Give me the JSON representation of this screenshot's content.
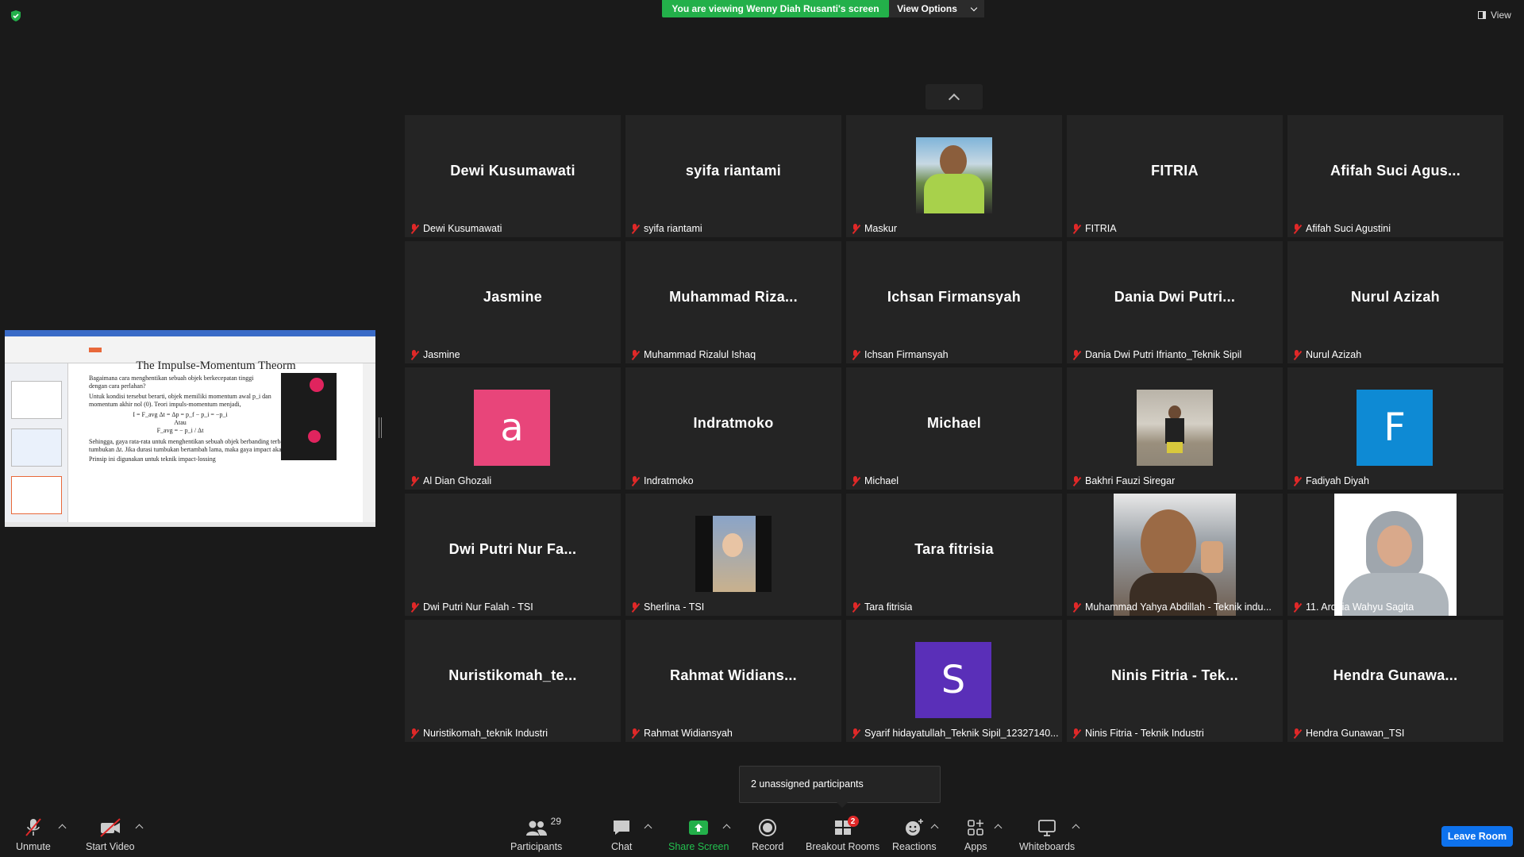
{
  "banner": {
    "viewing": "You are viewing Wenny Diah Rusanti's screen",
    "options": "View Options"
  },
  "view": {
    "label": "View"
  },
  "share_slide": {
    "title": "The Impulse-Momentum Theorm",
    "bullets": [
      "Bagaimana cara menghentikan sebuah objek berkecepatan tinggi dengan cara perlahan?",
      "Untuk kondisi tersebut berarti, objek memiliki momentum awal p_i dan momentum akhir nol (0). Teori impuls-momentum menjadi,",
      "Sehingga, gaya rata-rata untuk menghentikan sebuah objek berbanding terbalik dengan durasi tumbukan Δt. Jika durasi tumbukan bertambah lama, maka gaya impact akan berkurang.",
      "Prinsip ini digunakan untuk teknik impact-lossing"
    ],
    "eq1": "I = F_avg Δt = Δp = p_f − p_i = −p_i",
    "eq_or": "Atau",
    "eq2": "F_avg = − p_i / Δt"
  },
  "participants": [
    {
      "big": "Dewi Kusumawati",
      "label": "Dewi Kusumawati"
    },
    {
      "big": "syifa riantami",
      "label": "syifa riantami"
    },
    {
      "big": "",
      "label": "Maskur"
    },
    {
      "big": "FITRIA",
      "label": "FITRIA"
    },
    {
      "big": "Afifah  Suci  Agus...",
      "label": "Afifah Suci Agustini"
    },
    {
      "big": "Jasmine",
      "label": "Jasmine"
    },
    {
      "big": "Muhammad  Riza...",
      "label": "Muhammad Rizalul Ishaq"
    },
    {
      "big": "Ichsan Firmansyah",
      "label": "Ichsan Firmansyah"
    },
    {
      "big": "Dania  Dwi  Putri...",
      "label": "Dania Dwi Putri Ifrianto_Teknik Sipil"
    },
    {
      "big": "Nurul Azizah",
      "label": "Nurul Azizah"
    },
    {
      "big": "a",
      "label": "Al Dian Ghozali"
    },
    {
      "big": "Indratmoko",
      "label": "Indratmoko"
    },
    {
      "big": "Michael",
      "label": "Michael"
    },
    {
      "big": "",
      "label": "Bakhri Fauzi Siregar"
    },
    {
      "big": "F",
      "label": "Fadiyah Diyah"
    },
    {
      "big": "Dwi Putri Nur Fa...",
      "label": "Dwi Putri Nur Falah - TSI"
    },
    {
      "big": "",
      "label": "Sherlina - TSI"
    },
    {
      "big": "Tara fitrisia",
      "label": "Tara fitrisia"
    },
    {
      "big": "",
      "label": "Muhammad Yahya Abdillah - Teknik indu..."
    },
    {
      "big": "",
      "label": "11. Ardhia Wahyu Sagita"
    },
    {
      "big": "Nuristikomah_te...",
      "label": "Nuristikomah_teknik Industri"
    },
    {
      "big": "Rahmat  Widians...",
      "label": "Rahmat Widiansyah"
    },
    {
      "big": "S",
      "label": "Syarif hidayatullah_Teknik Sipil_12327140..."
    },
    {
      "big": "Ninis Fitria - Tek...",
      "label": "Ninis Fitria - Teknik Industri"
    },
    {
      "big": "Hendra  Gunawa...",
      "label": "Hendra Gunawan_TSI"
    }
  ],
  "avatar_colors": {
    "a": "#e8457a",
    "F": "#0e8ad4",
    "S": "#5a2fb8"
  },
  "tooltip": "2 unassigned participants",
  "toolbar": {
    "unmute": "Unmute",
    "start_video": "Start Video",
    "participants": "Participants",
    "participants_count": "29",
    "chat": "Chat",
    "share_screen": "Share Screen",
    "record": "Record",
    "breakout": "Breakout Rooms",
    "breakout_badge": "2",
    "reactions": "Reactions",
    "apps": "Apps",
    "whiteboards": "Whiteboards",
    "leave": "Leave Room"
  },
  "colors": {
    "share_green": "#23b04a",
    "leave_blue": "#0e72ed",
    "mute_red": "#e02828"
  }
}
